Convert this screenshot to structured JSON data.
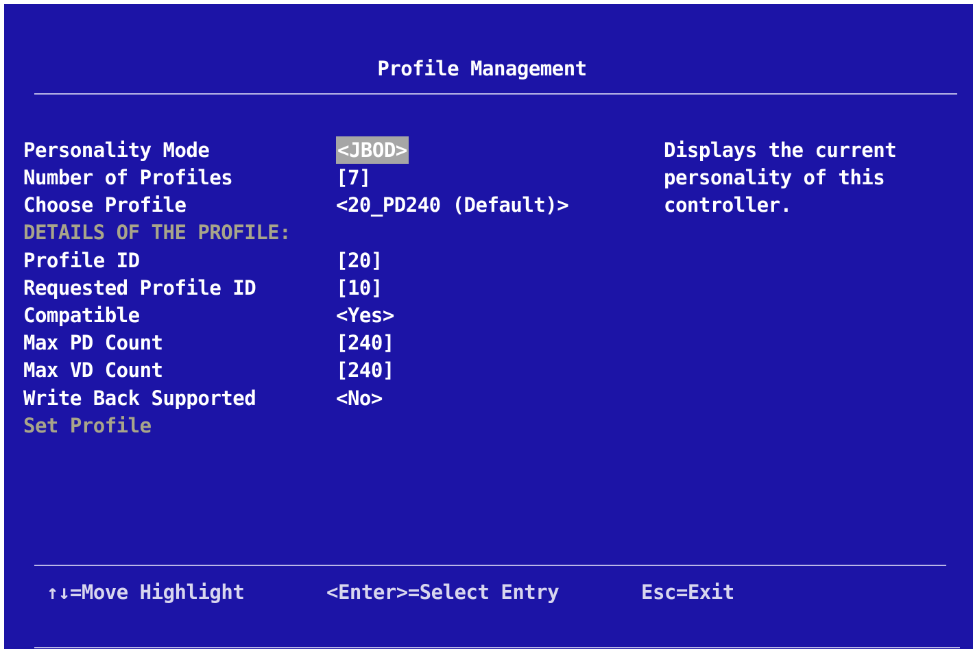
{
  "title": "Profile Management",
  "rows": [
    {
      "label": "Personality Mode",
      "value": "<JBOD>"
    },
    {
      "label": "Number of Profiles",
      "value": "[7]"
    },
    {
      "label": "Choose Profile",
      "value": "<20_PD240 (Default)>"
    },
    {
      "label": "DETAILS OF THE PROFILE:",
      "value": ""
    },
    {
      "label": "Profile ID",
      "value": "[20]"
    },
    {
      "label": "Requested Profile ID",
      "value": "[10]"
    },
    {
      "label": "Compatible",
      "value": "<Yes>"
    },
    {
      "label": "Max PD Count",
      "value": "[240]"
    },
    {
      "label": "Max VD Count",
      "value": "[240]"
    },
    {
      "label": "Write Back Supported",
      "value": "<No>"
    },
    {
      "label": "Set Profile",
      "value": ""
    }
  ],
  "help": {
    "lines": [
      "Displays the current",
      "personality of this",
      "controller."
    ]
  },
  "footer": {
    "move": "↑↓=Move Highlight",
    "select": "<Enter>=Select Entry",
    "exit": "Esc=Exit"
  },
  "colors": {
    "background": "#1c14a6",
    "text": "#ffffff",
    "disabled_text": "#a8a58a",
    "highlight": "#a6a6a6"
  }
}
